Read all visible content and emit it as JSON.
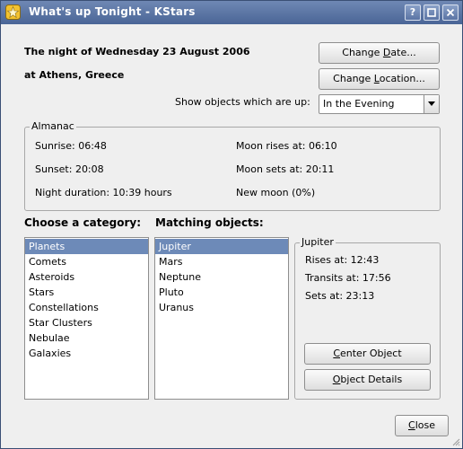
{
  "window": {
    "title": "What's up Tonight - KStars",
    "help_label": "?",
    "icon": "kstars-app-icon"
  },
  "header": {
    "night_text": "The night of Wednesday 23 August 2006",
    "location_text": "at Athens, Greece",
    "change_date_pre": "Change ",
    "change_date_key": "D",
    "change_date_post": "ate...",
    "change_location_pre": "Change ",
    "change_location_key": "L",
    "change_location_post": "ocation...",
    "show_label": "Show objects which are up:",
    "show_value": "In the Evening"
  },
  "almanac": {
    "title": "Almanac",
    "sunrise": "Sunrise: 06:48",
    "sunset": "Sunset: 20:08",
    "night_duration": "Night duration: 10:39 hours",
    "moon_rises": "Moon rises at: 06:10",
    "moon_sets": "Moon sets at: 20:11",
    "moon_phase": "New moon (0%)"
  },
  "categories": {
    "title": "Choose a category:",
    "items": [
      "Planets",
      "Comets",
      "Asteroids",
      "Stars",
      "Constellations",
      "Star Clusters",
      "Nebulae",
      "Galaxies"
    ],
    "selected": "Planets"
  },
  "matching": {
    "title": "Matching objects:",
    "items": [
      "Jupiter",
      "Mars",
      "Neptune",
      "Pluto",
      "Uranus"
    ],
    "selected": "Jupiter"
  },
  "details": {
    "title": "Jupiter",
    "rises": "Rises at: 12:43",
    "transits": "Transits at: 17:56",
    "sets": "Sets at: 23:13",
    "center_key": "C",
    "center_post": "enter Object",
    "details_key": "O",
    "details_post": "bject Details"
  },
  "footer": {
    "close_key": "C",
    "close_post": "lose"
  },
  "colors": {
    "titlebar": "#4a6596",
    "selection": "#6d8ab8",
    "background": "#efefef"
  }
}
